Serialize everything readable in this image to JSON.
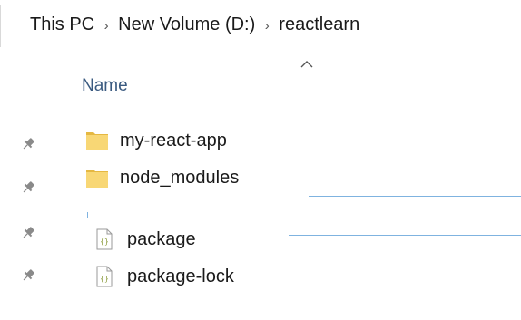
{
  "breadcrumb": {
    "items": [
      "This PC",
      "New Volume (D:)",
      "reactlearn"
    ],
    "separator": "›"
  },
  "list_header": {
    "name_label": "Name",
    "sort": "ascending"
  },
  "files": [
    {
      "name": "my-react-app",
      "type": "folder",
      "pinned": true
    },
    {
      "name": "node_modules",
      "type": "folder",
      "pinned": true
    },
    {
      "name": "package",
      "type": "json-file",
      "pinned": true
    },
    {
      "name": "package-lock",
      "type": "json-file",
      "pinned": true
    }
  ],
  "colors": {
    "folder_yellow": "#F8D775",
    "folder_dark": "#E5B842",
    "header_blue": "#3A5A80",
    "drag_line_blue": "#7FB3E0",
    "pin_gray": "#8A8A8A"
  }
}
